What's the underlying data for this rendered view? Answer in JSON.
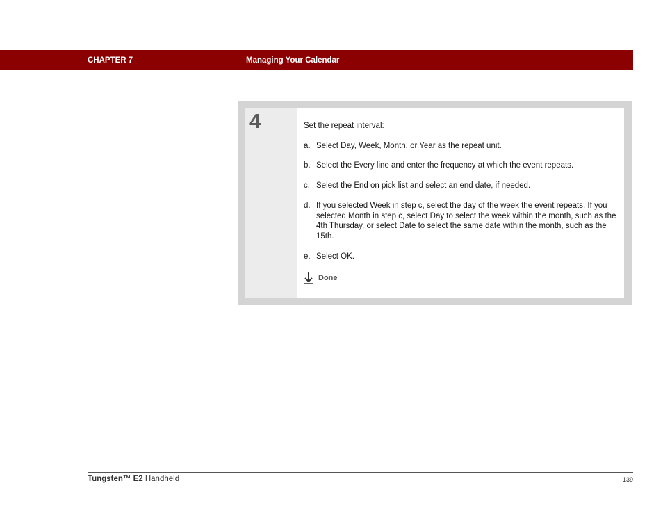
{
  "header": {
    "chapter": "CHAPTER 7",
    "title": "Managing Your Calendar",
    "bar_color": "#8b0000"
  },
  "step": {
    "number": "4",
    "intro": "Set the repeat interval:",
    "items": [
      {
        "marker": "a.",
        "text": "Select Day, Week, Month, or Year as the repeat unit."
      },
      {
        "marker": "b.",
        "text": "Select the Every line and enter the frequency at which the event repeats."
      },
      {
        "marker": "c.",
        "text": "Select the End on pick list and select an end date, if needed."
      },
      {
        "marker": "d.",
        "text": "If you selected Week in step c, select the day of the week the event repeats. If you selected Month in step c, select Day to select the week within the month, such as the 4th Thursday, or select Date to select the same date within the month, such as the 15th."
      },
      {
        "marker": "e.",
        "text": "Select OK."
      }
    ],
    "done_icon": "down-arrow-icon",
    "done_label": "Done"
  },
  "footer": {
    "product_bold": "Tungsten™ E2",
    "product_rest": " Handheld",
    "page_number": "139"
  }
}
